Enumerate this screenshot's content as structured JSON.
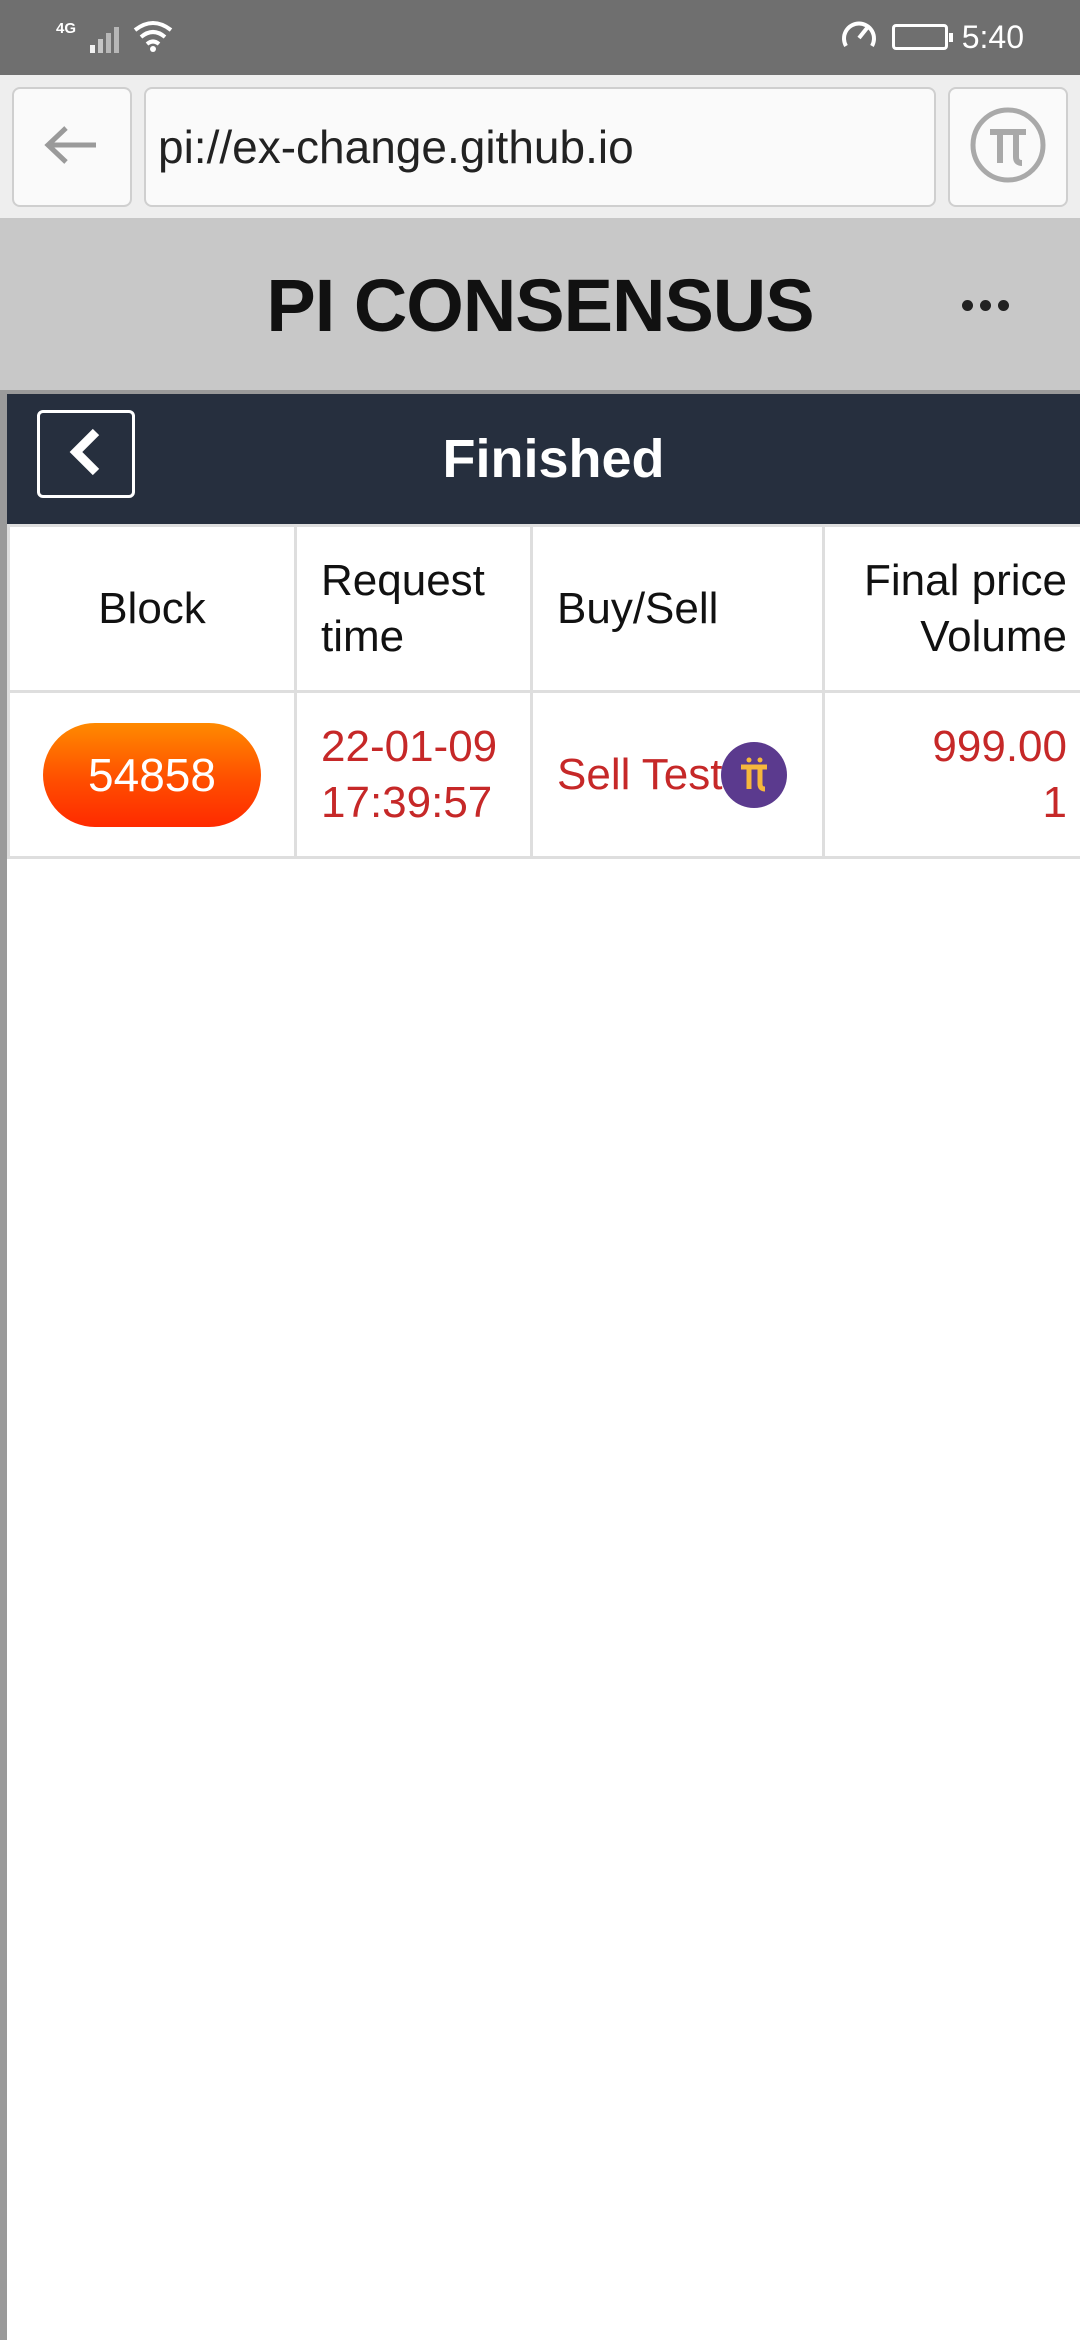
{
  "status_bar": {
    "network": "4G",
    "time": "5:40",
    "icons": [
      "signal-icon",
      "wifi-icon",
      "speedometer-icon",
      "battery-icon"
    ]
  },
  "browser": {
    "url": "pi://ex-change.github.io",
    "back_icon": "arrow-left-icon",
    "pi_icon": "pi-logo-icon"
  },
  "app": {
    "title": "PI CONSENSUS",
    "menu_icon": "more-horizontal-icon"
  },
  "page": {
    "title": "Finished",
    "back_icon": "chevron-left-icon"
  },
  "table": {
    "headers": {
      "block": "Block",
      "request_time": [
        "Request",
        "time"
      ],
      "buy_sell": "Buy/Sell",
      "final_price_volume": [
        "Final price",
        "Volume"
      ]
    },
    "rows": [
      {
        "block": "54858",
        "request_time": [
          "22-01-09",
          "17:39:57"
        ],
        "buy_sell": "Sell Test",
        "final_price": "999.00",
        "volume": "1"
      }
    ]
  },
  "colors": {
    "status_bar": "#6f6f6f",
    "nav_bar": "#262f3e",
    "header_bg": "#c8c8c8",
    "sell_text": "#c62828",
    "pill_orange": "#ff5a00",
    "pi_coin": "#5b3a8e"
  }
}
